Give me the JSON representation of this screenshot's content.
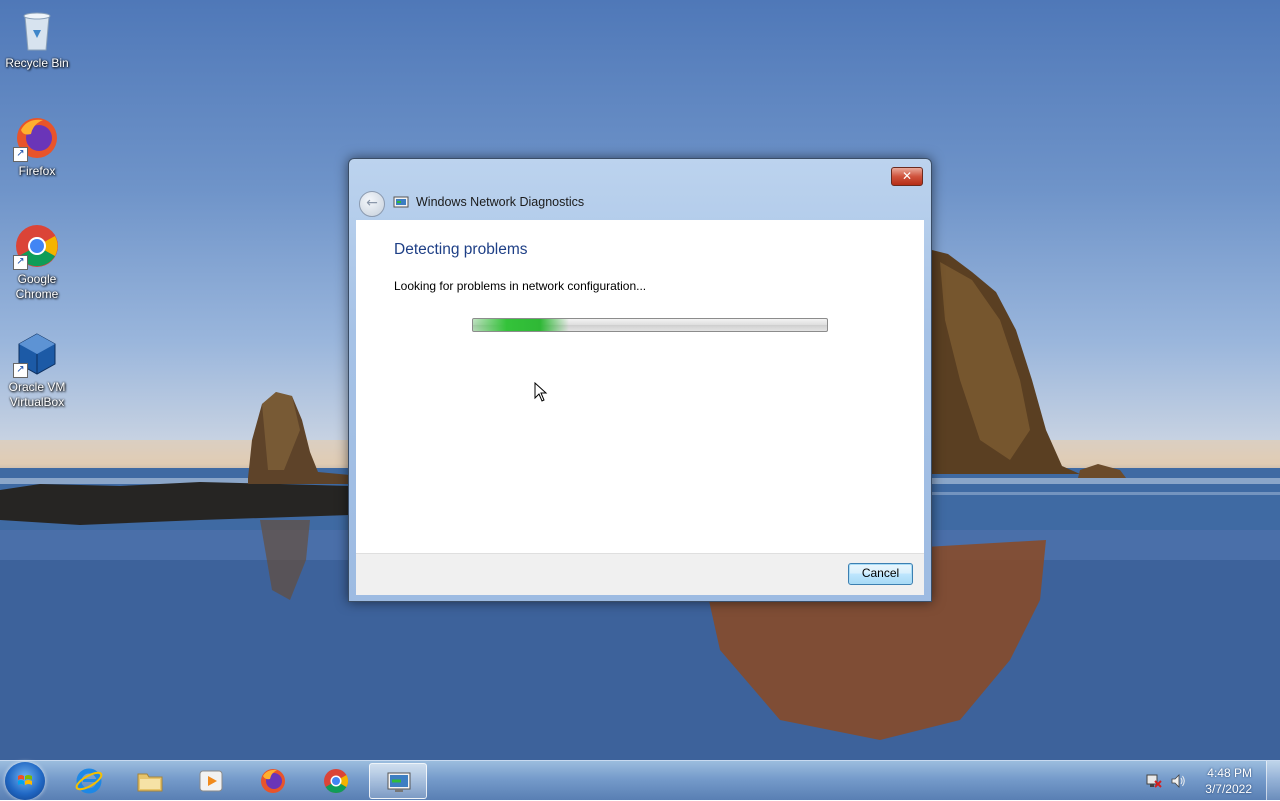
{
  "desktop": {
    "icons": [
      {
        "label": "Recycle Bin",
        "icon": "recycle-bin-icon"
      },
      {
        "label": "Firefox",
        "icon": "firefox-icon"
      },
      {
        "label": "Google Chrome",
        "icon": "chrome-icon"
      },
      {
        "label": "Oracle VM VirtualBox",
        "icon": "virtualbox-icon"
      }
    ]
  },
  "dialog": {
    "title": "Windows Network Diagnostics",
    "heading": "Detecting problems",
    "status": "Looking for problems in network configuration...",
    "progress_fraction": 0.27,
    "close_glyph": "✕",
    "back_glyph": "←",
    "cancel_label": "Cancel",
    "accent_color": "#1e3f86",
    "progress_color": "#34c33a"
  },
  "taskbar": {
    "pinned": [
      {
        "name": "internet-explorer",
        "icon": "internet-explorer-icon"
      },
      {
        "name": "windows-explorer",
        "icon": "folder-icon"
      },
      {
        "name": "media-player",
        "icon": "media-player-icon"
      },
      {
        "name": "firefox",
        "icon": "firefox-icon"
      },
      {
        "name": "chrome",
        "icon": "chrome-icon"
      },
      {
        "name": "network-diagnostics",
        "icon": "network-diagnostics-icon",
        "active": true
      }
    ],
    "clock": {
      "time": "4:48 PM",
      "date": "3/7/2022"
    }
  }
}
